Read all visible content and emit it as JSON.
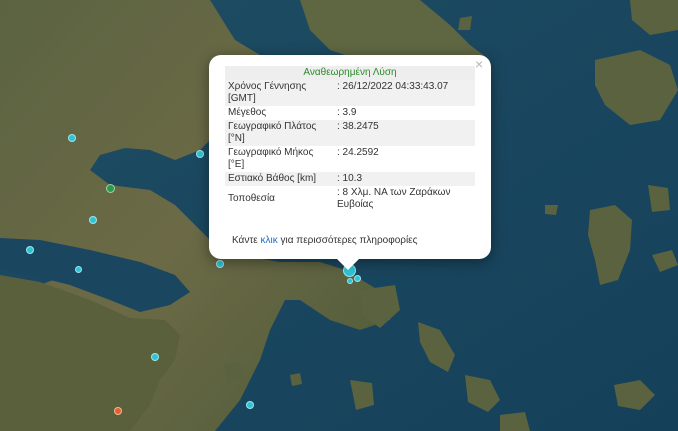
{
  "popup": {
    "title": "Αναθεωρημένη Λύση",
    "close_symbol": "×",
    "rows": [
      {
        "label": "Χρόνος Γέννησης [GMT]",
        "value": ": 26/12/2022 04:33:43.07"
      },
      {
        "label": "Μέγεθος",
        "value": ": 3.9"
      },
      {
        "label": "Γεωγραφικό Πλάτος [°N]",
        "value": ": 38.2475"
      },
      {
        "label": "Γεωγραφικό Μήκος [°E]",
        "value": ": 24.2592"
      },
      {
        "label": "Εστιακό Βάθος [km]",
        "value": ": 10.3"
      },
      {
        "label": "Τοποθεσία",
        "value": ": 8 Χλμ. ΝΑ των Ζαράκων Ευβοίας"
      }
    ],
    "more_prefix": "Κάντε ",
    "more_link": "κλικ",
    "more_suffix": " για περισσότερες πληροφορίες"
  },
  "colors": {
    "sea": "#1f4f66",
    "land": "#4f5a3a",
    "marker_cyan": "#2ec4d6",
    "marker_green": "#2f9a4a",
    "marker_orange": "#e0622a",
    "popup_title": "#2a8a2a",
    "link": "#1a6fc8"
  }
}
